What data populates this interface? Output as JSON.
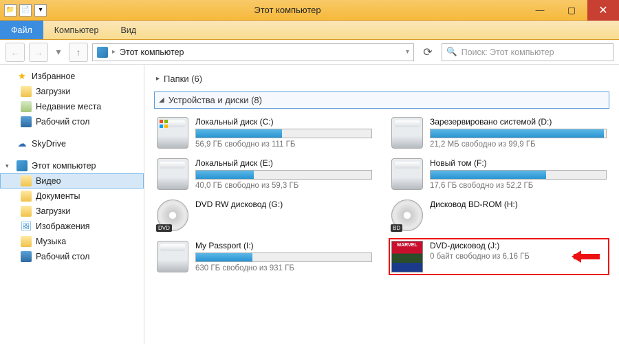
{
  "window": {
    "title": "Этот компьютер"
  },
  "menu": {
    "file": "Файл",
    "computer": "Компьютер",
    "view": "Вид"
  },
  "address": {
    "crumb": "Этот компьютер"
  },
  "search": {
    "placeholder": "Поиск: Этот компьютер"
  },
  "sidebar": {
    "favorites": {
      "label": "Избранное",
      "items": [
        {
          "label": "Загрузки"
        },
        {
          "label": "Недавние места"
        },
        {
          "label": "Рабочий стол"
        }
      ]
    },
    "skydrive": {
      "label": "SkyDrive"
    },
    "thispc": {
      "label": "Этот компьютер",
      "items": [
        {
          "label": "Видео"
        },
        {
          "label": "Документы"
        },
        {
          "label": "Загрузки"
        },
        {
          "label": "Изображения"
        },
        {
          "label": "Музыка"
        },
        {
          "label": "Рабочий стол"
        }
      ]
    }
  },
  "sections": {
    "folders": {
      "label": "Папки (6)"
    },
    "devices": {
      "label": "Устройства и диски (8)"
    }
  },
  "drives": [
    {
      "name": "Локальный диск (C:)",
      "free": "56,9 ГБ свободно из 111 ГБ",
      "fill": 49,
      "type": "hdd-win"
    },
    {
      "name": "Зарезервировано системой (D:)",
      "free": "21,2 МБ свободно из 99,9 ГБ",
      "fill": 99,
      "type": "hdd"
    },
    {
      "name": "Локальный диск (E:)",
      "free": "40,0 ГБ свободно из 59,3 ГБ",
      "fill": 33,
      "type": "hdd"
    },
    {
      "name": "Новый том (F:)",
      "free": "17,6 ГБ свободно из 52,2 ГБ",
      "fill": 66,
      "type": "hdd"
    },
    {
      "name": "DVD RW дисковод (G:)",
      "free": "",
      "fill": 0,
      "type": "dvd",
      "badge": "DVD"
    },
    {
      "name": "Дисковод BD-ROM (H:)",
      "free": "",
      "fill": 0,
      "type": "dvd",
      "badge": "BD"
    },
    {
      "name": "My Passport (I:)",
      "free": "630 ГБ свободно из 931 ГБ",
      "fill": 32,
      "type": "hdd"
    },
    {
      "name": "DVD-дисковод (J:)",
      "free": "0 байт свободно из 6,16 ГБ",
      "fill": 100,
      "type": "marvel",
      "highlighted": true
    }
  ]
}
